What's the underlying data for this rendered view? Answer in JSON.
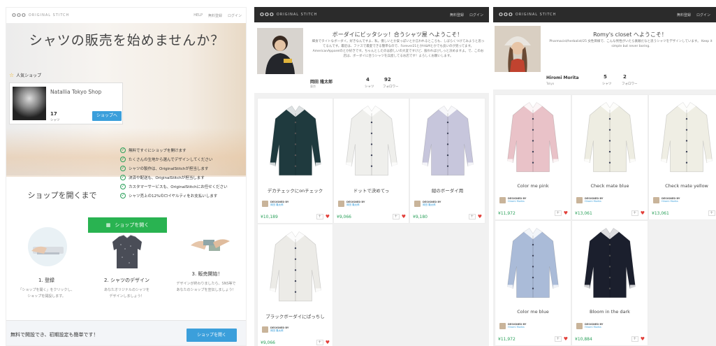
{
  "landing": {
    "logo_mark": "OOO",
    "logo_text": "ORIGINAL STITCH",
    "nav": [
      "HELP",
      "無料登録",
      "ログイン"
    ],
    "hero_title": "シャツの販売を始めませんか？",
    "popular_label": "人気ショップ",
    "shop": {
      "name": "Natallia Tokyo Shop",
      "count": "17",
      "unit": "シャツ",
      "button": "ショップへ"
    },
    "benefits": [
      "無料ですぐにショップを開けます",
      "たくさんの生地から選んでデザインしてください",
      "シャツの製作は、OriginalStitchが担当します",
      "決済や配送も、OriginalStitchが担当します",
      "カスタマーサービスも、OriginalStitchにお任せください",
      "シャツ売上の12%のロイヤルティをお支払いします"
    ],
    "steps_title": "ショップを開くまで",
    "open_button": "ショップを開く",
    "steps": [
      {
        "title": "1. 登録",
        "desc": [
          "「ショップを開く」をクリックし、",
          "ショップを開設します。"
        ]
      },
      {
        "title": "2. シャツのデザイン",
        "desc": [
          "あなたオリジナルのシャツを",
          "デザインしましょう！"
        ]
      },
      {
        "title": "3. 販売開始！",
        "desc": [
          "デザインが終わりましたら、SNS等で",
          "あなたのショップを宣伝しましょう！"
        ]
      }
    ],
    "bottom_text": "無料で開設でき、初期設定も簡単です！",
    "bottom_button": "ショップを開く"
  },
  "shop1": {
    "logo_mark": "OOO",
    "logo_text": "ORIGINAL STITCH",
    "nav": [
      "無料登録",
      "ログイン"
    ],
    "welcome": "ボーダイにビッタシッ！合うシャツ屋 へようこそ！",
    "bio": [
      "細身でタイトなボーダイ。好きなんですよ、私。僕しいとか安っぽいとか言われるところも、しばらくつけてみようと思ってるんです。最近は、ファスで最愛できる簡単なので、Forever21とかH&Mとかでも良いのが売ってます。AmericanApparelのとか好きです。ちゃんとしたのは欲しいの大変ですけど、服わればびしっと決めますよ。で、このお店は、ボーダイに合うシャツを兵屋してるお店です！よろしくお願いします。"
    ],
    "owner": "岡田 隆太郎",
    "location": "東京",
    "shirts_count": "4",
    "shirts_label": "シャツ",
    "followers_count": "92",
    "followers_label": "フォロワー",
    "designed_by": "DESIGNED BY",
    "designer_link": "岡田 隆太郎",
    "products": [
      {
        "title": "デカチェックにonチェック",
        "price": "¥10,189",
        "color": "#1f3a3e"
      },
      {
        "title": "ドットで決めてっ",
        "price": "¥9,066",
        "color": "#efefec"
      },
      {
        "title": "紺のボーダイ用",
        "price": "¥9,180",
        "color": "#c7c6dc"
      },
      {
        "title": "ブラックボーダイにぱっちし",
        "price": "¥9,066",
        "color": "#ecebe7"
      }
    ]
  },
  "shop2": {
    "logo_mark": "OOO",
    "logo_text": "ORIGINAL STITCH",
    "nav": [
      "無料登録",
      "ログイン"
    ],
    "welcome": "Romy's closet へようこそ！",
    "bio": [
      "Pharmacist/herbalist/25 女性目線で、こんな男性がいたら素敵だなと思うシャツをデザインしています。 Keep it simple but never boring."
    ],
    "owner": "Hiromi Morita",
    "location": "Tokyo",
    "shirts_count": "5",
    "shirts_label": "シャツ",
    "followers_count": "2",
    "followers_label": "フォロワー",
    "designed_by": "DESIGNED BY",
    "designer_link": "Hiromi Morita",
    "products": [
      {
        "title": "Color me pink",
        "price": "¥11,972",
        "color": "#e9c2c8"
      },
      {
        "title": "Check mate blue",
        "price": "¥13,061",
        "color": "#eeede2"
      },
      {
        "title": "Check mate yellow",
        "price": "¥13,061",
        "color": "#efeee4"
      },
      {
        "title": "Color me blue",
        "price": "¥11,972",
        "color": "#aabbd8"
      },
      {
        "title": "Bloom in the dark",
        "price": "¥10,884",
        "color": "#1b1f2d"
      }
    ]
  }
}
